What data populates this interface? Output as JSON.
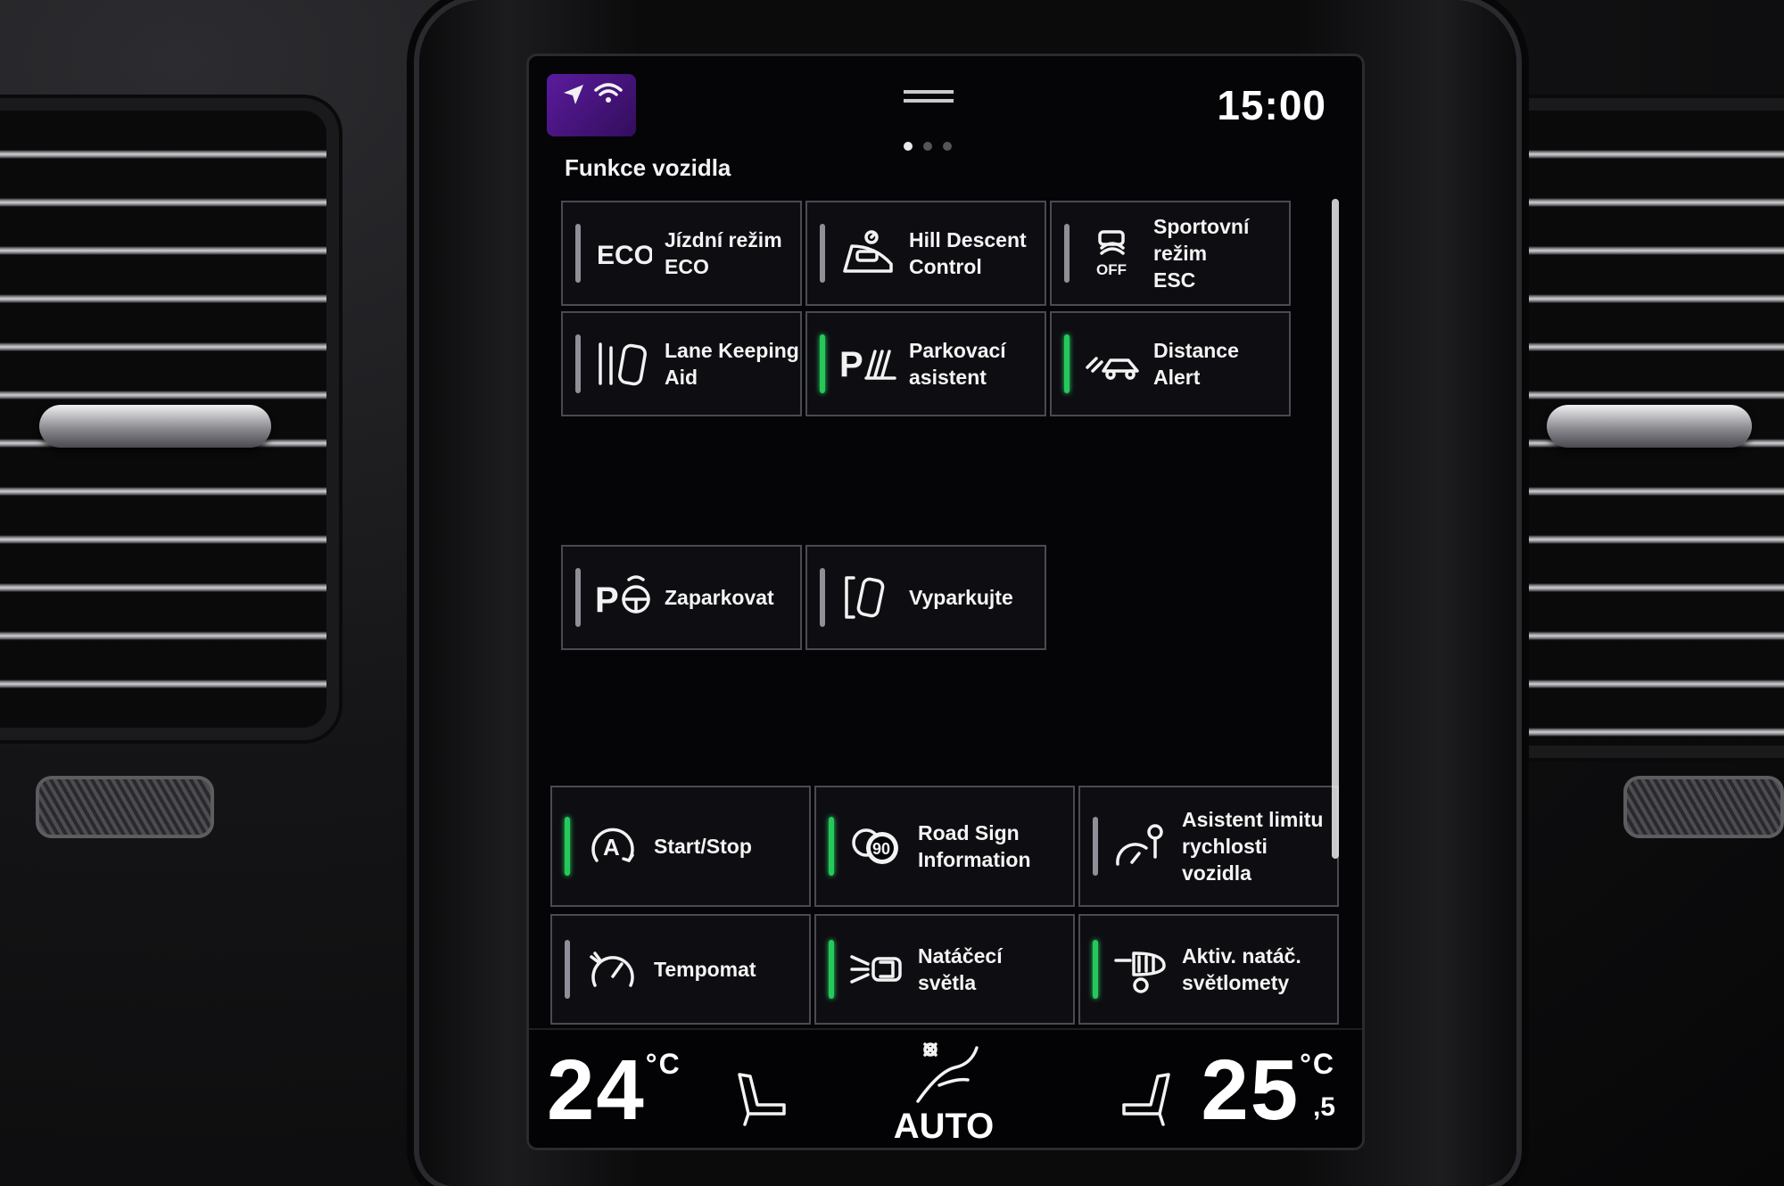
{
  "status_bar": {
    "clock": "15:00",
    "page_count": 3,
    "active_page": 0
  },
  "section_title": "Funkce vozidla",
  "tiles": [
    {
      "label": "Jízdní režim\nECO",
      "icon": "eco-text-icon",
      "icon_text": "ECO",
      "active": false
    },
    {
      "label": "Hill Descent\nControl",
      "icon": "hill-descent-icon",
      "active": false
    },
    {
      "label": "Sportovní režim\nESC",
      "icon": "esc-off-icon",
      "icon_text": "OFF",
      "active": false
    },
    {
      "label": "Lane Keeping\nAid",
      "icon": "lane-keeping-icon",
      "active": false
    },
    {
      "label": "Parkovací\nasistent",
      "icon": "park-assist-icon",
      "icon_text": "P",
      "active": true
    },
    {
      "label": "Distance Alert",
      "icon": "distance-alert-icon",
      "active": true
    },
    {
      "label": "Zaparkovat",
      "icon": "park-in-icon",
      "icon_text": "P",
      "active": false
    },
    {
      "label": "Vyparkujte",
      "icon": "park-out-icon",
      "active": false
    },
    {
      "label": "Start/Stop",
      "icon": "start-stop-icon",
      "icon_text": "A",
      "active": true
    },
    {
      "label": "Road Sign\nInformation",
      "icon": "road-sign-icon",
      "icon_text": "90",
      "active": true
    },
    {
      "label": "Asistent limitu\nrychlosti vozidla",
      "icon": "speed-limiter-icon",
      "active": false
    },
    {
      "label": "Tempomat",
      "icon": "cruise-control-icon",
      "active": false
    },
    {
      "label": "Natáčecí\nsvětla",
      "icon": "bending-lights-icon",
      "active": true
    },
    {
      "label": "Aktiv. natáč.\nsvětlomety",
      "icon": "active-headlights-icon",
      "active": true
    }
  ],
  "climate": {
    "left_temp": "24",
    "left_unit": "°C",
    "right_temp": "25",
    "right_unit": "°C",
    "right_decimal": ",5",
    "fan_mode": "AUTO"
  },
  "colors": {
    "indicator_on": "#25c95a",
    "indicator_off": "#8f8f97",
    "text": "#f2f2f2",
    "screen_bg": "#050508",
    "status_tint": "#6a1fb8"
  }
}
